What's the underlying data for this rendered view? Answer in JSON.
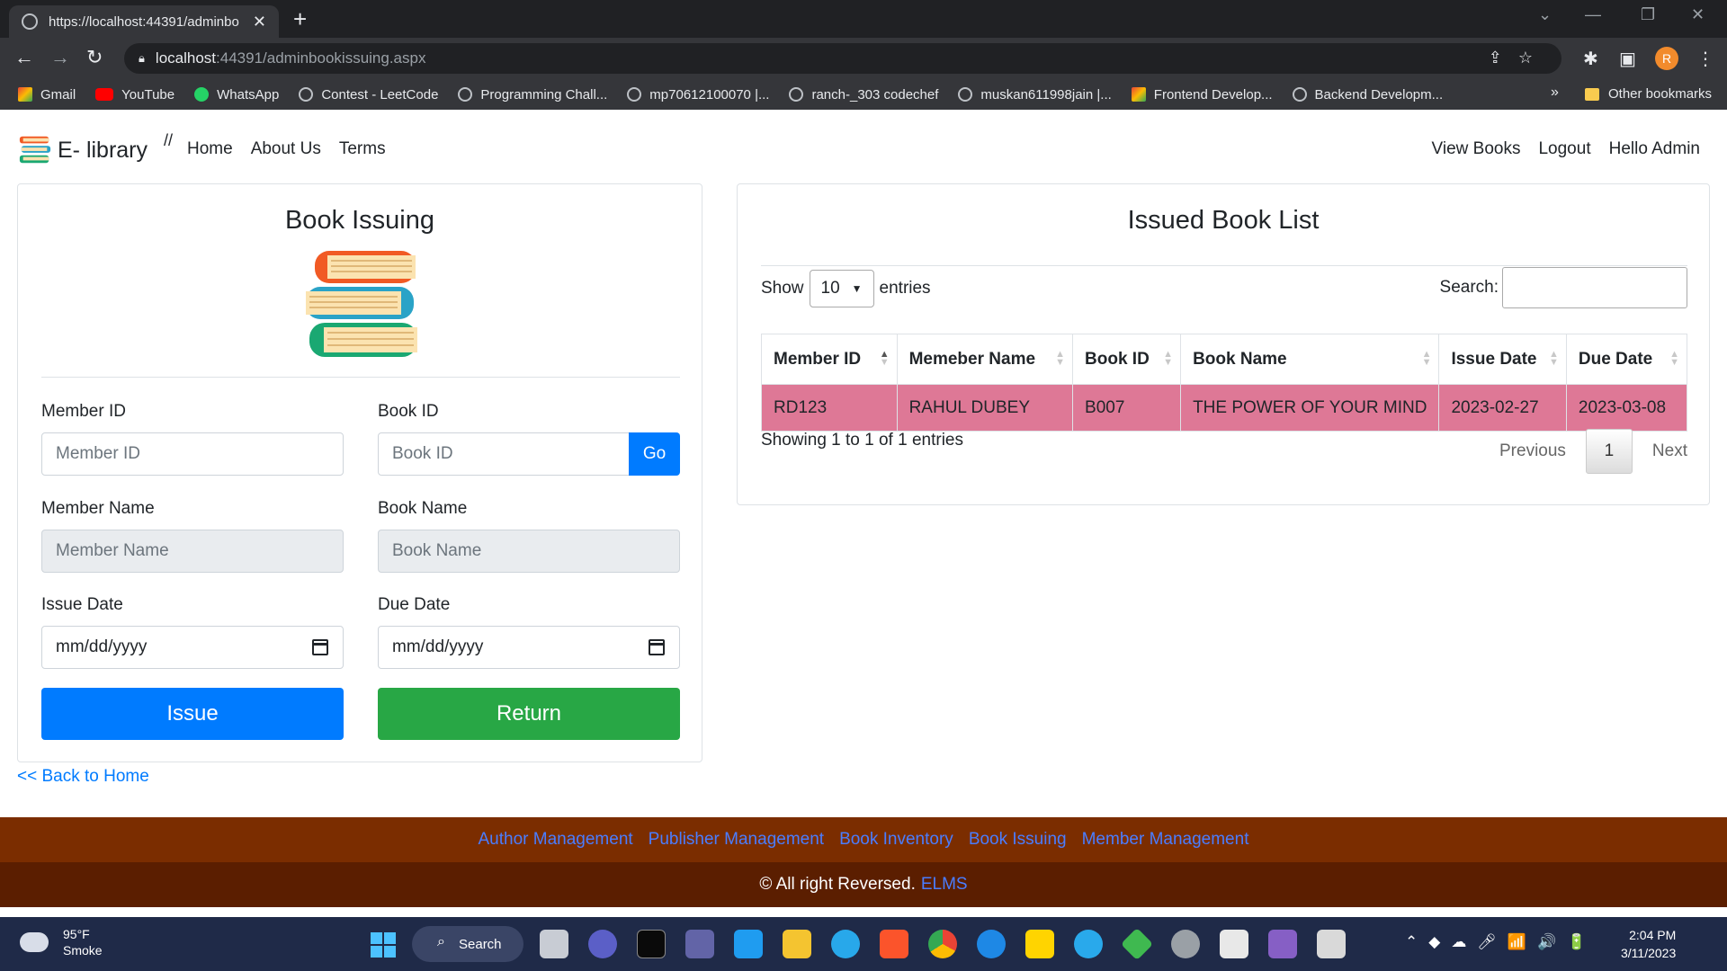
{
  "browser": {
    "tab_title": "https://localhost:44391/adminbo",
    "url_host": "localhost",
    "url_path": ":44391/adminbookissuing.aspx",
    "profile_initial": "R",
    "bookmarks": [
      {
        "label": "Gmail",
        "icon": "gmail-icon"
      },
      {
        "label": "YouTube",
        "icon": "youtube-icon"
      },
      {
        "label": "WhatsApp",
        "icon": "whatsapp-icon"
      },
      {
        "label": "Contest - LeetCode",
        "icon": "globe-icon"
      },
      {
        "label": "Programming Chall...",
        "icon": "globe-icon"
      },
      {
        "label": "mp70612100070 |...",
        "icon": "globe-icon"
      },
      {
        "label": "ranch-_303 codechef",
        "icon": "globe-icon"
      },
      {
        "label": "muskan611998jain |...",
        "icon": "globe-icon"
      },
      {
        "label": "Frontend Develop...",
        "icon": "gmail-icon"
      },
      {
        "label": "Backend Developm...",
        "icon": "globe-icon"
      }
    ],
    "bookmarks_more": "»",
    "other_bookmarks": "Other bookmarks"
  },
  "navbar": {
    "brand": "E- library",
    "separator": "//",
    "left_links": [
      "Home",
      "About Us",
      "Terms"
    ],
    "right_links": [
      "View Books",
      "Logout",
      "Hello Admin"
    ]
  },
  "issuing": {
    "title": "Book Issuing",
    "member_id_label": "Member ID",
    "member_id_placeholder": "Member ID",
    "book_id_label": "Book ID",
    "book_id_placeholder": "Book ID",
    "go_label": "Go",
    "member_name_label": "Member Name",
    "member_name_placeholder": "Member Name",
    "book_name_label": "Book Name",
    "book_name_placeholder": "Book Name",
    "issue_date_label": "Issue Date",
    "issue_date_value": "mm/dd/yyyy",
    "due_date_label": "Due Date",
    "due_date_value": "mm/dd/yyyy",
    "issue_button": "Issue",
    "return_button": "Return",
    "back_link": "<< Back to Home"
  },
  "issued_list": {
    "title": "Issued Book List",
    "show_label": "Show",
    "entries_value": "10",
    "entries_label": "entries",
    "search_label": "Search:",
    "columns": [
      "Member ID",
      "Memeber Name",
      "Book ID",
      "Book Name",
      "Issue Date",
      "Due Date"
    ],
    "rows": [
      [
        "RD123",
        "RAHUL DUBEY",
        "B007",
        "THE POWER OF YOUR MIND",
        "2023-02-27",
        "2023-03-08"
      ]
    ],
    "row_highlight_color": "#de7896",
    "info": "Showing 1 to 1 of 1 entries",
    "prev_label": "Previous",
    "page": "1",
    "next_label": "Next"
  },
  "footer": {
    "links": [
      "Author Management",
      "Publisher Management",
      "Book Inventory",
      "Book Issuing",
      "Member Management"
    ],
    "copyright": "© All right Reversed.",
    "brand": "ELMS"
  },
  "taskbar": {
    "temperature": "95°F",
    "condition": "Smoke",
    "search_label": "Search",
    "time": "2:04 PM",
    "date": "3/11/2023"
  },
  "colors": {
    "primary": "#007bff",
    "success": "#28a745",
    "footer_top": "#7b2d00",
    "footer_bottom": "#5b1e00"
  }
}
